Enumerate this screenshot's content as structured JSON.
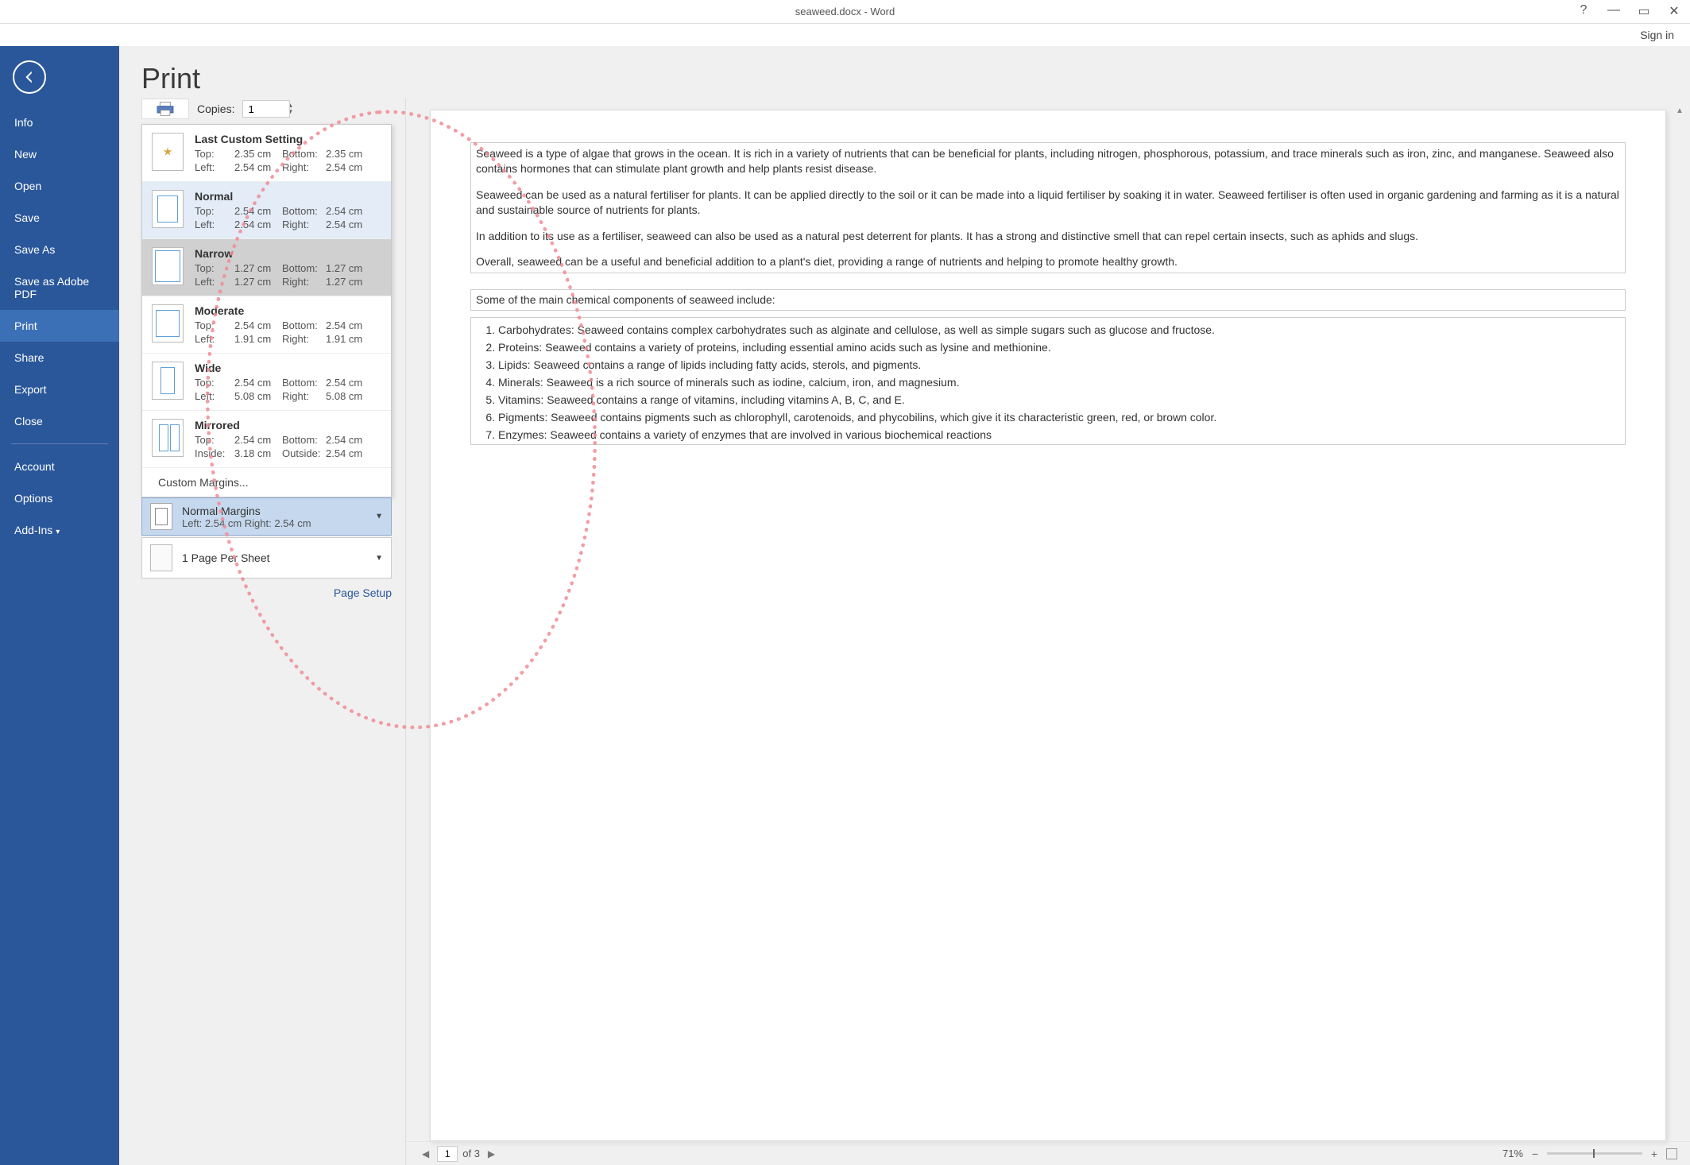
{
  "window": {
    "title": "seaweed.docx - Word",
    "help": "?",
    "signin": "Sign in"
  },
  "sidebar": {
    "items": [
      "Info",
      "New",
      "Open",
      "Save",
      "Save As",
      "Save as Adobe PDF",
      "Print",
      "Share",
      "Export",
      "Close"
    ],
    "lower": [
      "Account",
      "Options",
      "Add-Ins"
    ],
    "active": "Print"
  },
  "print": {
    "heading": "Print",
    "copies_label": "Copies:",
    "copies_value": "1",
    "page_setup": "Page Setup",
    "custom_margins": "Custom Margins...",
    "selected_margin": {
      "title": "Normal Margins",
      "detail": "Left: 2.54 cm   Right: 2.54 cm"
    },
    "pages_per_sheet": "1 Page Per Sheet",
    "margin_options": [
      {
        "name": "Last Custom Setting",
        "top": "2.35 cm",
        "bottom": "2.35 cm",
        "left": "2.54 cm",
        "right": "2.54 cm",
        "thumb": "star"
      },
      {
        "name": "Normal",
        "top": "2.54 cm",
        "bottom": "2.54 cm",
        "left": "2.54 cm",
        "right": "2.54 cm",
        "thumb": "normal",
        "selected": true
      },
      {
        "name": "Narrow",
        "top": "1.27 cm",
        "bottom": "1.27 cm",
        "left": "1.27 cm",
        "right": "1.27 cm",
        "thumb": "narrow",
        "highlight": true
      },
      {
        "name": "Moderate",
        "top": "2.54 cm",
        "bottom": "2.54 cm",
        "left": "1.91 cm",
        "right": "1.91 cm",
        "thumb": "moderate"
      },
      {
        "name": "Wide",
        "top": "2.54 cm",
        "bottom": "2.54 cm",
        "left": "5.08 cm",
        "right": "5.08 cm",
        "thumb": "wide"
      },
      {
        "name": "Mirrored",
        "top": "2.54 cm",
        "bottom": "2.54 cm",
        "left_lbl": "Inside:",
        "left": "3.18 cm",
        "right_lbl": "Outside:",
        "right": "2.54 cm",
        "thumb": "mirror"
      }
    ],
    "labels": {
      "top": "Top:",
      "bottom": "Bottom:",
      "left": "Left:",
      "right": "Right:"
    }
  },
  "preview": {
    "p1": "Seaweed is a type of algae that grows in the ocean. It is rich in a variety of nutrients that can be beneficial for plants, including nitrogen, phosphorous, potassium, and trace minerals such as iron, zinc, and manganese. Seaweed also contains hormones that can stimulate plant growth and help plants resist disease.",
    "p2": "Seaweed can be used as a natural fertiliser for plants. It can be applied directly to the soil or it can be made into a liquid fertiliser by soaking it in water. Seaweed fertiliser is often used in organic gardening and farming as it is a natural and sustainable source of nutrients for plants.",
    "p3": "In addition to its use as a fertiliser, seaweed can also be used as a natural pest deterrent for plants. It has a strong and distinctive smell that can repel certain insects, such as aphids and slugs.",
    "p4": "Overall, seaweed can be a useful and beneficial addition to a plant's diet, providing a range of nutrients and helping to promote healthy growth.",
    "h2": "Some of the main chemical components of seaweed include:",
    "li1": "Carbohydrates: Seaweed contains complex carbohydrates such as alginate and cellulose, as well as simple sugars such as glucose and fructose.",
    "li2": "Proteins: Seaweed contains a variety of proteins, including essential amino acids such as lysine and methionine.",
    "li3": "Lipids: Seaweed contains a range of lipids including fatty acids, sterols, and pigments.",
    "li4": "Minerals: Seaweed is a rich source of minerals such as iodine, calcium, iron, and magnesium.",
    "li5": "Vitamins: Seaweed contains a range of vitamins, including vitamins A, B, C, and E.",
    "li6": "Pigments: Seaweed contains pigments such as chlorophyll, carotenoids, and phycobilins, which give it its characteristic green, red, or brown color.",
    "li7": "Enzymes: Seaweed contains a variety of enzymes that are involved in various biochemical reactions"
  },
  "status": {
    "page_current": "1",
    "page_total_label": "of 3",
    "zoom": "71%"
  }
}
